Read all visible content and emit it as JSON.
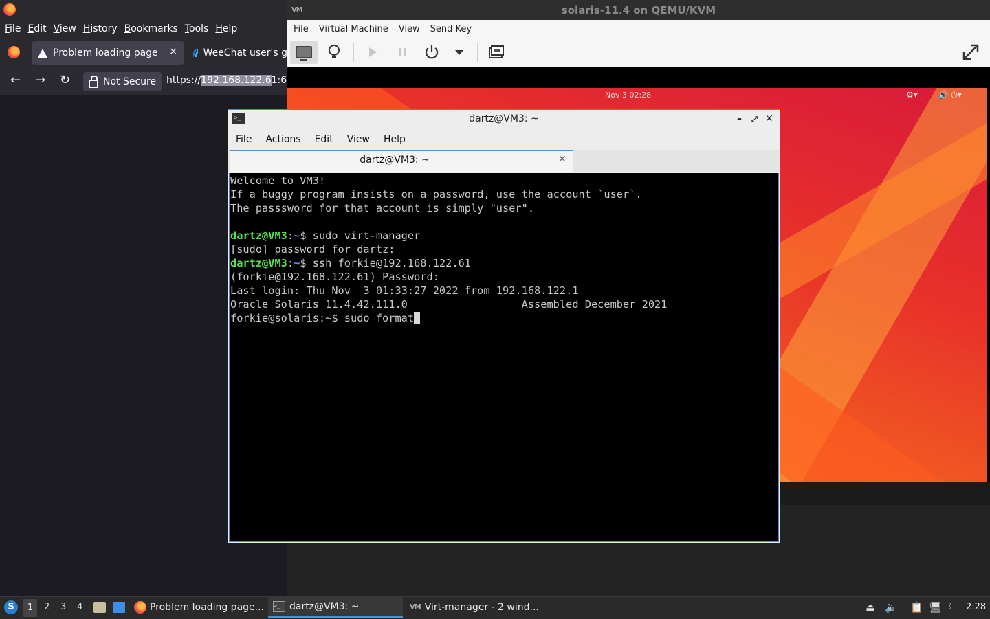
{
  "firefox": {
    "menu": [
      "File",
      "Edit",
      "View",
      "History",
      "Bookmarks",
      "Tools",
      "Help"
    ],
    "tabs": [
      {
        "label": "Problem loading page",
        "close": "×"
      },
      {
        "label": "WeeChat user's g"
      }
    ],
    "nav": {
      "back": "←",
      "forward": "→",
      "reload": "↻"
    },
    "security_label": "Not Secure",
    "url_prefix": "https://",
    "url_selected": "192.168.122.6",
    "url_suffix": "1:6"
  },
  "virt_manager": {
    "title": "solaris-11.4 on QEMU/KVM",
    "menu": [
      "File",
      "Virtual Machine",
      "View",
      "Send Key"
    ],
    "toolbar": {
      "details_icon": "lightbulb-icon",
      "run_icon": "play-icon",
      "pause_icon": "pause-icon",
      "power_icon": "power-icon",
      "power_menu_icon": "chevron-down-icon",
      "snapshot_icon": "snapshot-icon",
      "fullscreen_icon": "fullscreen-icon"
    },
    "guest": {
      "clock": "Nov 3  02:28"
    }
  },
  "terminal": {
    "title": "dartz@VM3: ~",
    "menu": [
      "File",
      "Actions",
      "Edit",
      "View",
      "Help"
    ],
    "tab_label": "dartz@VM3: ~",
    "lines": {
      "l1": "Welcome to VM3!",
      "l2": "If a buggy program insists on a password, use the account `user`.",
      "l3": "The passsword for that account is simply \"user\".",
      "prompt_user": "dartz@VM3",
      "prompt_sep": ":",
      "prompt_path": "~",
      "cmd1": "$ sudo virt-manager",
      "l5": "[sudo] password for dartz:",
      "cmd2": "$ ssh forkie@192.168.122.61",
      "l7": "(forkie@192.168.122.61) Password:",
      "l8": "Last login: Thu Nov  3 01:33:27 2022 from 192.168.122.1",
      "l9": "Oracle Solaris 11.4.42.111.0                  Assembled December 2021",
      "l10": "forkie@solaris:~$ sudo format"
    }
  },
  "taskbar": {
    "workspaces": [
      "1",
      "2",
      "3",
      "4"
    ],
    "tasks": [
      {
        "label": "Problem loading page..."
      },
      {
        "label": "dartz@VM3: ~"
      },
      {
        "label": "Virt-manager - 2 wind..."
      }
    ],
    "clock": "2:28"
  },
  "colors": {
    "prompt_green": "#55e24b",
    "prompt_blue": "#6a8ff2",
    "focus_blue": "#5b86c6"
  }
}
